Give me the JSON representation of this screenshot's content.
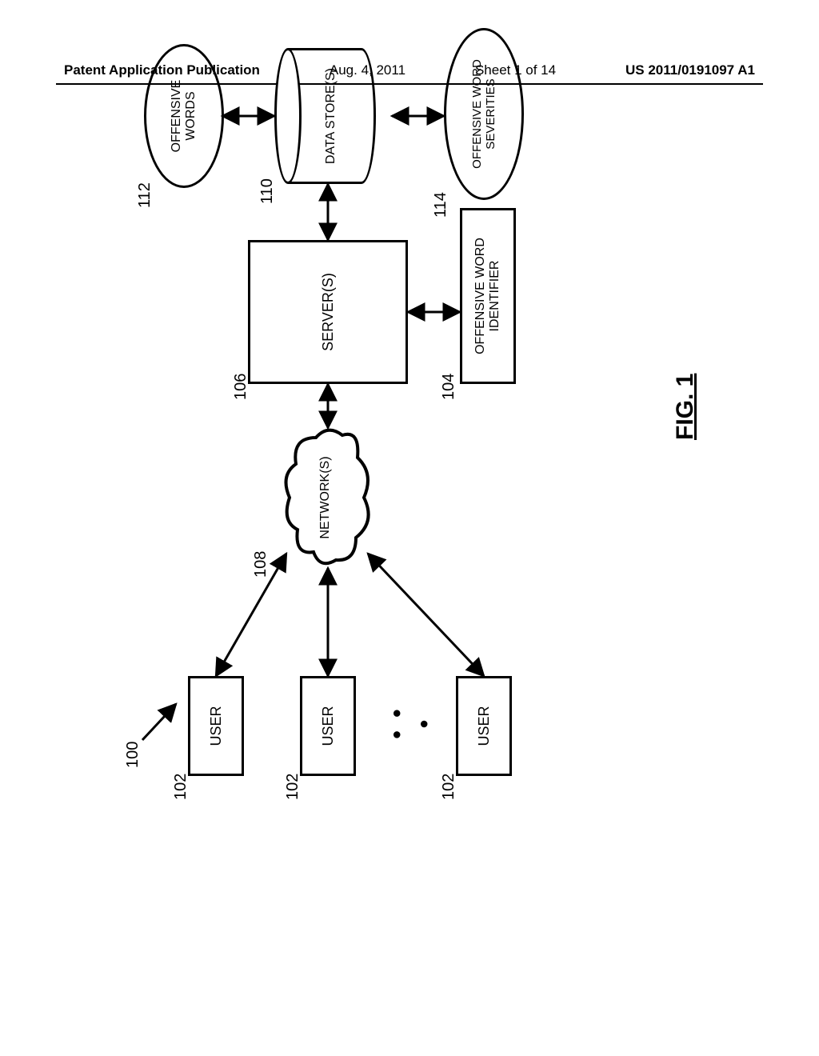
{
  "header": {
    "publication": "Patent Application Publication",
    "date": "Aug. 4, 2011",
    "sheet": "Sheet 1 of 14",
    "idno": "US 2011/0191097 A1"
  },
  "figure_caption": "FIG. 1",
  "ref_numbers": {
    "overall": "100",
    "user1": "102",
    "user2": "102",
    "user3": "102",
    "network": "108",
    "server": "106",
    "identifier": "104",
    "datastore": "110",
    "words": "112",
    "severities": "114"
  },
  "labels": {
    "user": "USER",
    "dots": "• • •",
    "network": "NETWORK(S)",
    "server": "SERVER(S)",
    "identifier": "OFFENSIVE WORD\nIDENTIFIER",
    "datastore": "DATA STORE(S)",
    "words": "OFFENSIVE\nWORDS",
    "severities": "OFFENSIVE WORD\nSEVERITIES"
  }
}
